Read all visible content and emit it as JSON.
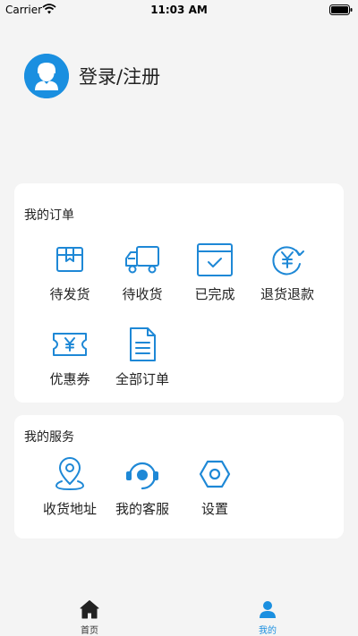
{
  "status_bar": {
    "carrier": "Carrier",
    "time": "11:03 AM"
  },
  "profile": {
    "login_label": "登录/注册"
  },
  "orders": {
    "title": "我的订单",
    "items": [
      {
        "label": "待发货",
        "icon": "package-box-icon"
      },
      {
        "label": "待收货",
        "icon": "delivery-truck-icon"
      },
      {
        "label": "已完成",
        "icon": "checked-box-icon"
      },
      {
        "label": "退货退款",
        "icon": "yuan-refund-icon"
      },
      {
        "label": "优惠券",
        "icon": "coupon-ticket-icon"
      },
      {
        "label": "全部订单",
        "icon": "document-list-icon"
      }
    ]
  },
  "services": {
    "title": "我的服务",
    "items": [
      {
        "label": "收货地址",
        "icon": "location-pin-icon"
      },
      {
        "label": "我的客服",
        "icon": "customer-service-icon"
      },
      {
        "label": "设置",
        "icon": "hexagon-nut-settings-icon"
      }
    ]
  },
  "tabbar": {
    "tabs": [
      {
        "label": "首页",
        "icon": "home-icon",
        "active": false
      },
      {
        "label": "我的",
        "icon": "user-icon",
        "active": true
      }
    ]
  },
  "colors": {
    "accent": "#1a8fe0",
    "icon_blue": "#1e88d6",
    "background": "#f4f4f4",
    "card": "#ffffff"
  }
}
